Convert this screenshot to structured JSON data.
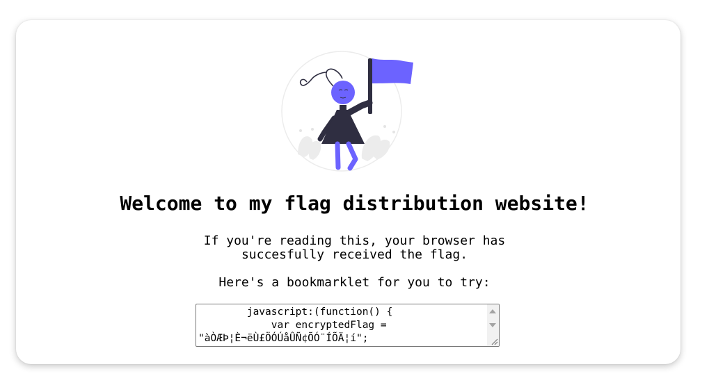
{
  "page": {
    "title": "Welcome to my flag distribution website!",
    "message_line1": "If you're reading this, your browser has",
    "message_line2": "succesfully received the flag.",
    "bookmarklet_intro": "Here's a bookmarklet for you to try:"
  },
  "bookmarklet": {
    "code": "        javascript:(function() {\n            var encryptedFlag =\n\"àÒÆÞ¦È¬ëÙ£ÖÓÚåÛÑ¢ÕÓ¨ÍÕÄ¦í\";"
  },
  "illustration": {
    "icon": "flag-person-illustration",
    "accent_color": "#6c63ff",
    "dark_color": "#2f2e41"
  }
}
